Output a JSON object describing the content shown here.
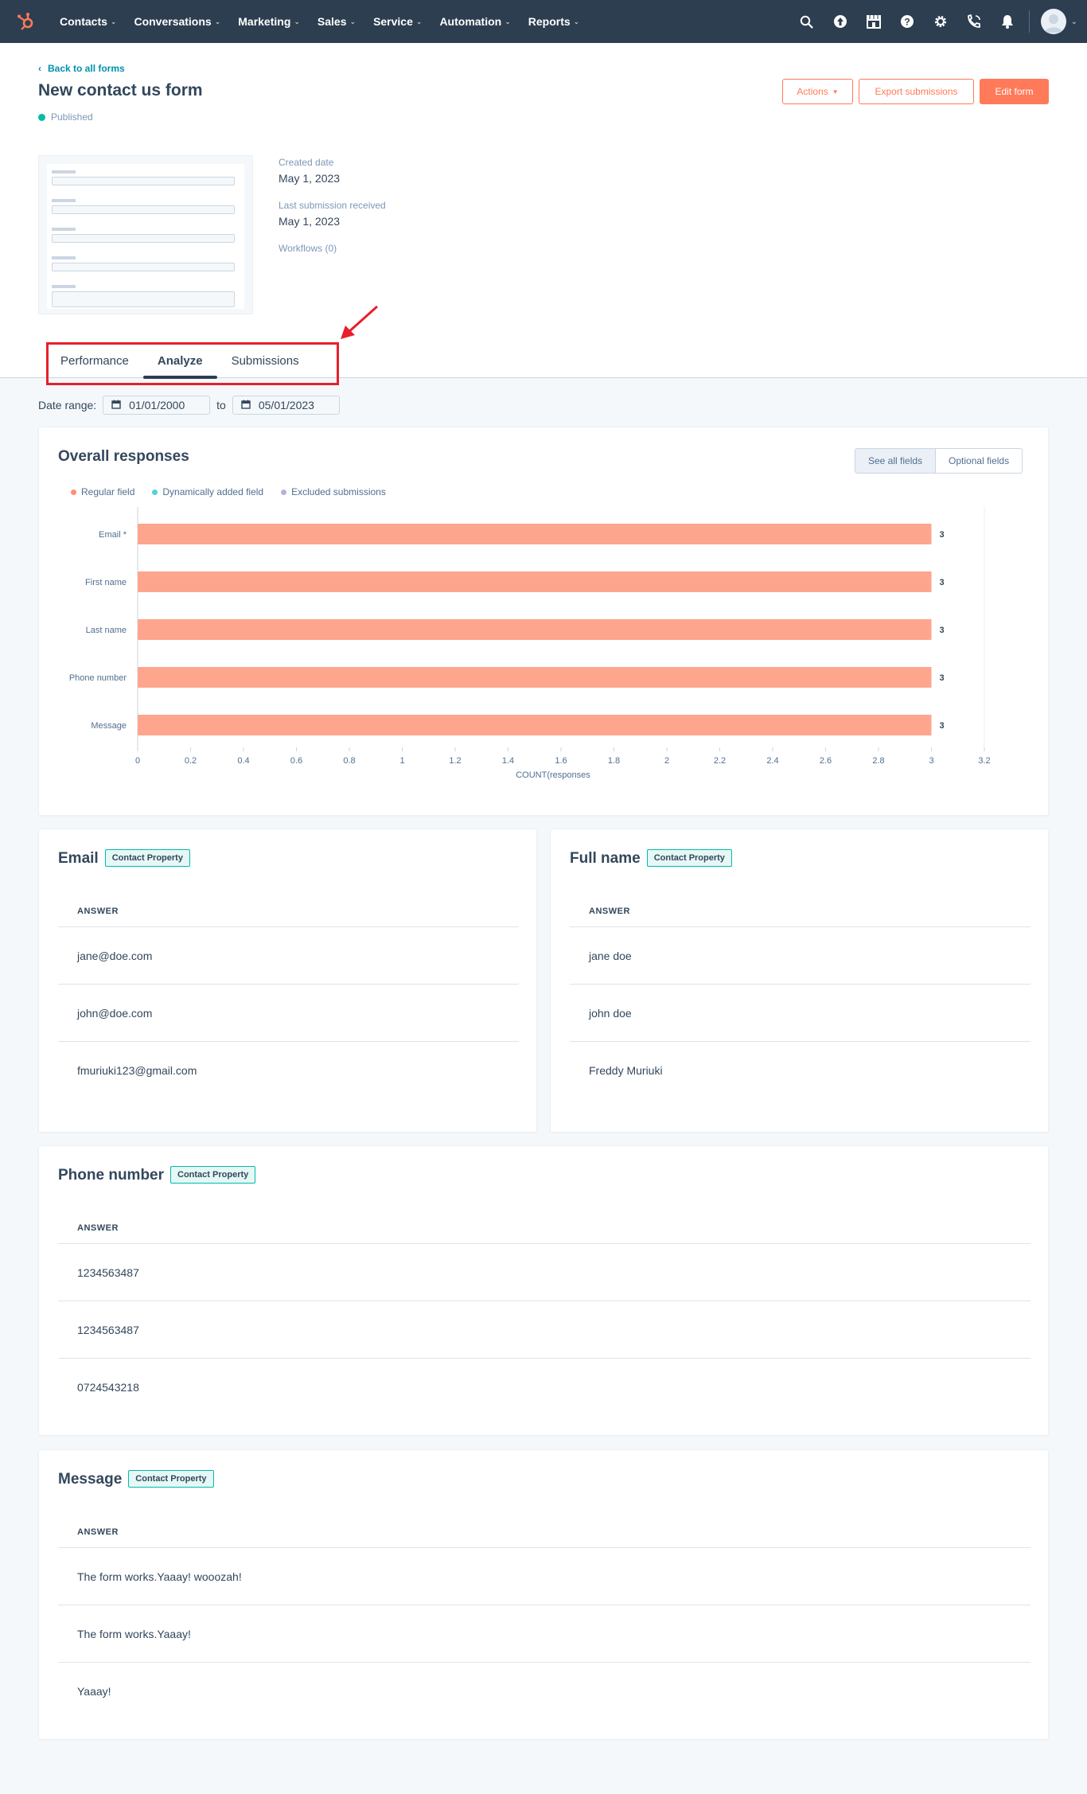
{
  "nav": {
    "items": [
      {
        "label": "Contacts"
      },
      {
        "label": "Conversations"
      },
      {
        "label": "Marketing"
      },
      {
        "label": "Sales"
      },
      {
        "label": "Service"
      },
      {
        "label": "Automation"
      },
      {
        "label": "Reports"
      }
    ]
  },
  "header": {
    "back_label": "Back to all forms",
    "title": "New contact us form",
    "status": "Published",
    "actions_label": "Actions",
    "export_label": "Export submissions",
    "edit_label": "Edit form"
  },
  "thumbnail": {
    "fields": [
      "Email *",
      "First name",
      "Last name",
      "Phone number",
      "Message"
    ]
  },
  "meta": {
    "created_label": "Created date",
    "created_value": "May 1, 2023",
    "last_submission_label": "Last submission received",
    "last_submission_value": "May 1, 2023",
    "workflows_label": "Workflows (0)"
  },
  "tabs": [
    {
      "label": "Performance"
    },
    {
      "label": "Analyze"
    },
    {
      "label": "Submissions"
    }
  ],
  "date_range": {
    "label": "Date range:",
    "from": "01/01/2000",
    "to_label": "to",
    "to": "05/01/2023"
  },
  "overall": {
    "title": "Overall responses",
    "see_all_label": "See all fields",
    "optional_label": "Optional fields",
    "legend": [
      {
        "label": "Regular field",
        "color": "#ff8f73"
      },
      {
        "label": "Dynamically added field",
        "color": "#51d3d9"
      },
      {
        "label": "Excluded submissions",
        "color": "#b9aeda"
      }
    ]
  },
  "chart_data": {
    "type": "bar",
    "orientation": "horizontal",
    "categories": [
      "Email *",
      "First name",
      "Last name",
      "Phone number",
      "Message"
    ],
    "values": [
      3,
      3,
      3,
      3,
      3
    ],
    "xlabel": "COUNT(responses",
    "ylabel": "",
    "xlim": [
      0,
      3.2
    ],
    "xticks": [
      "0",
      "0.2",
      "0.4",
      "0.6",
      "0.8",
      "1",
      "1.2",
      "1.4",
      "1.6",
      "1.8",
      "2",
      "2.2",
      "2.4",
      "2.6",
      "2.8",
      "3",
      "3.2"
    ],
    "bar_color": "#fea58e",
    "data_labels": [
      "3",
      "3",
      "3",
      "3",
      "3"
    ],
    "grid": false
  },
  "cards": {
    "tag_label": "Contact Property",
    "answer_header": "ANSWER",
    "email": {
      "title": "Email",
      "answers": [
        "jane@doe.com",
        "john@doe.com",
        "fmuriuki123@gmail.com"
      ]
    },
    "fullname": {
      "title": "Full name",
      "answers": [
        "jane doe",
        "john doe",
        "Freddy Muriuki"
      ]
    },
    "phone": {
      "title": "Phone number",
      "answers": [
        "1234563487",
        "1234563487",
        "0724543218"
      ]
    },
    "message": {
      "title": "Message",
      "answers": [
        "The form works.Yaaay! wooozah!",
        "The form works.Yaaay!",
        "Yaaay!"
      ]
    }
  }
}
